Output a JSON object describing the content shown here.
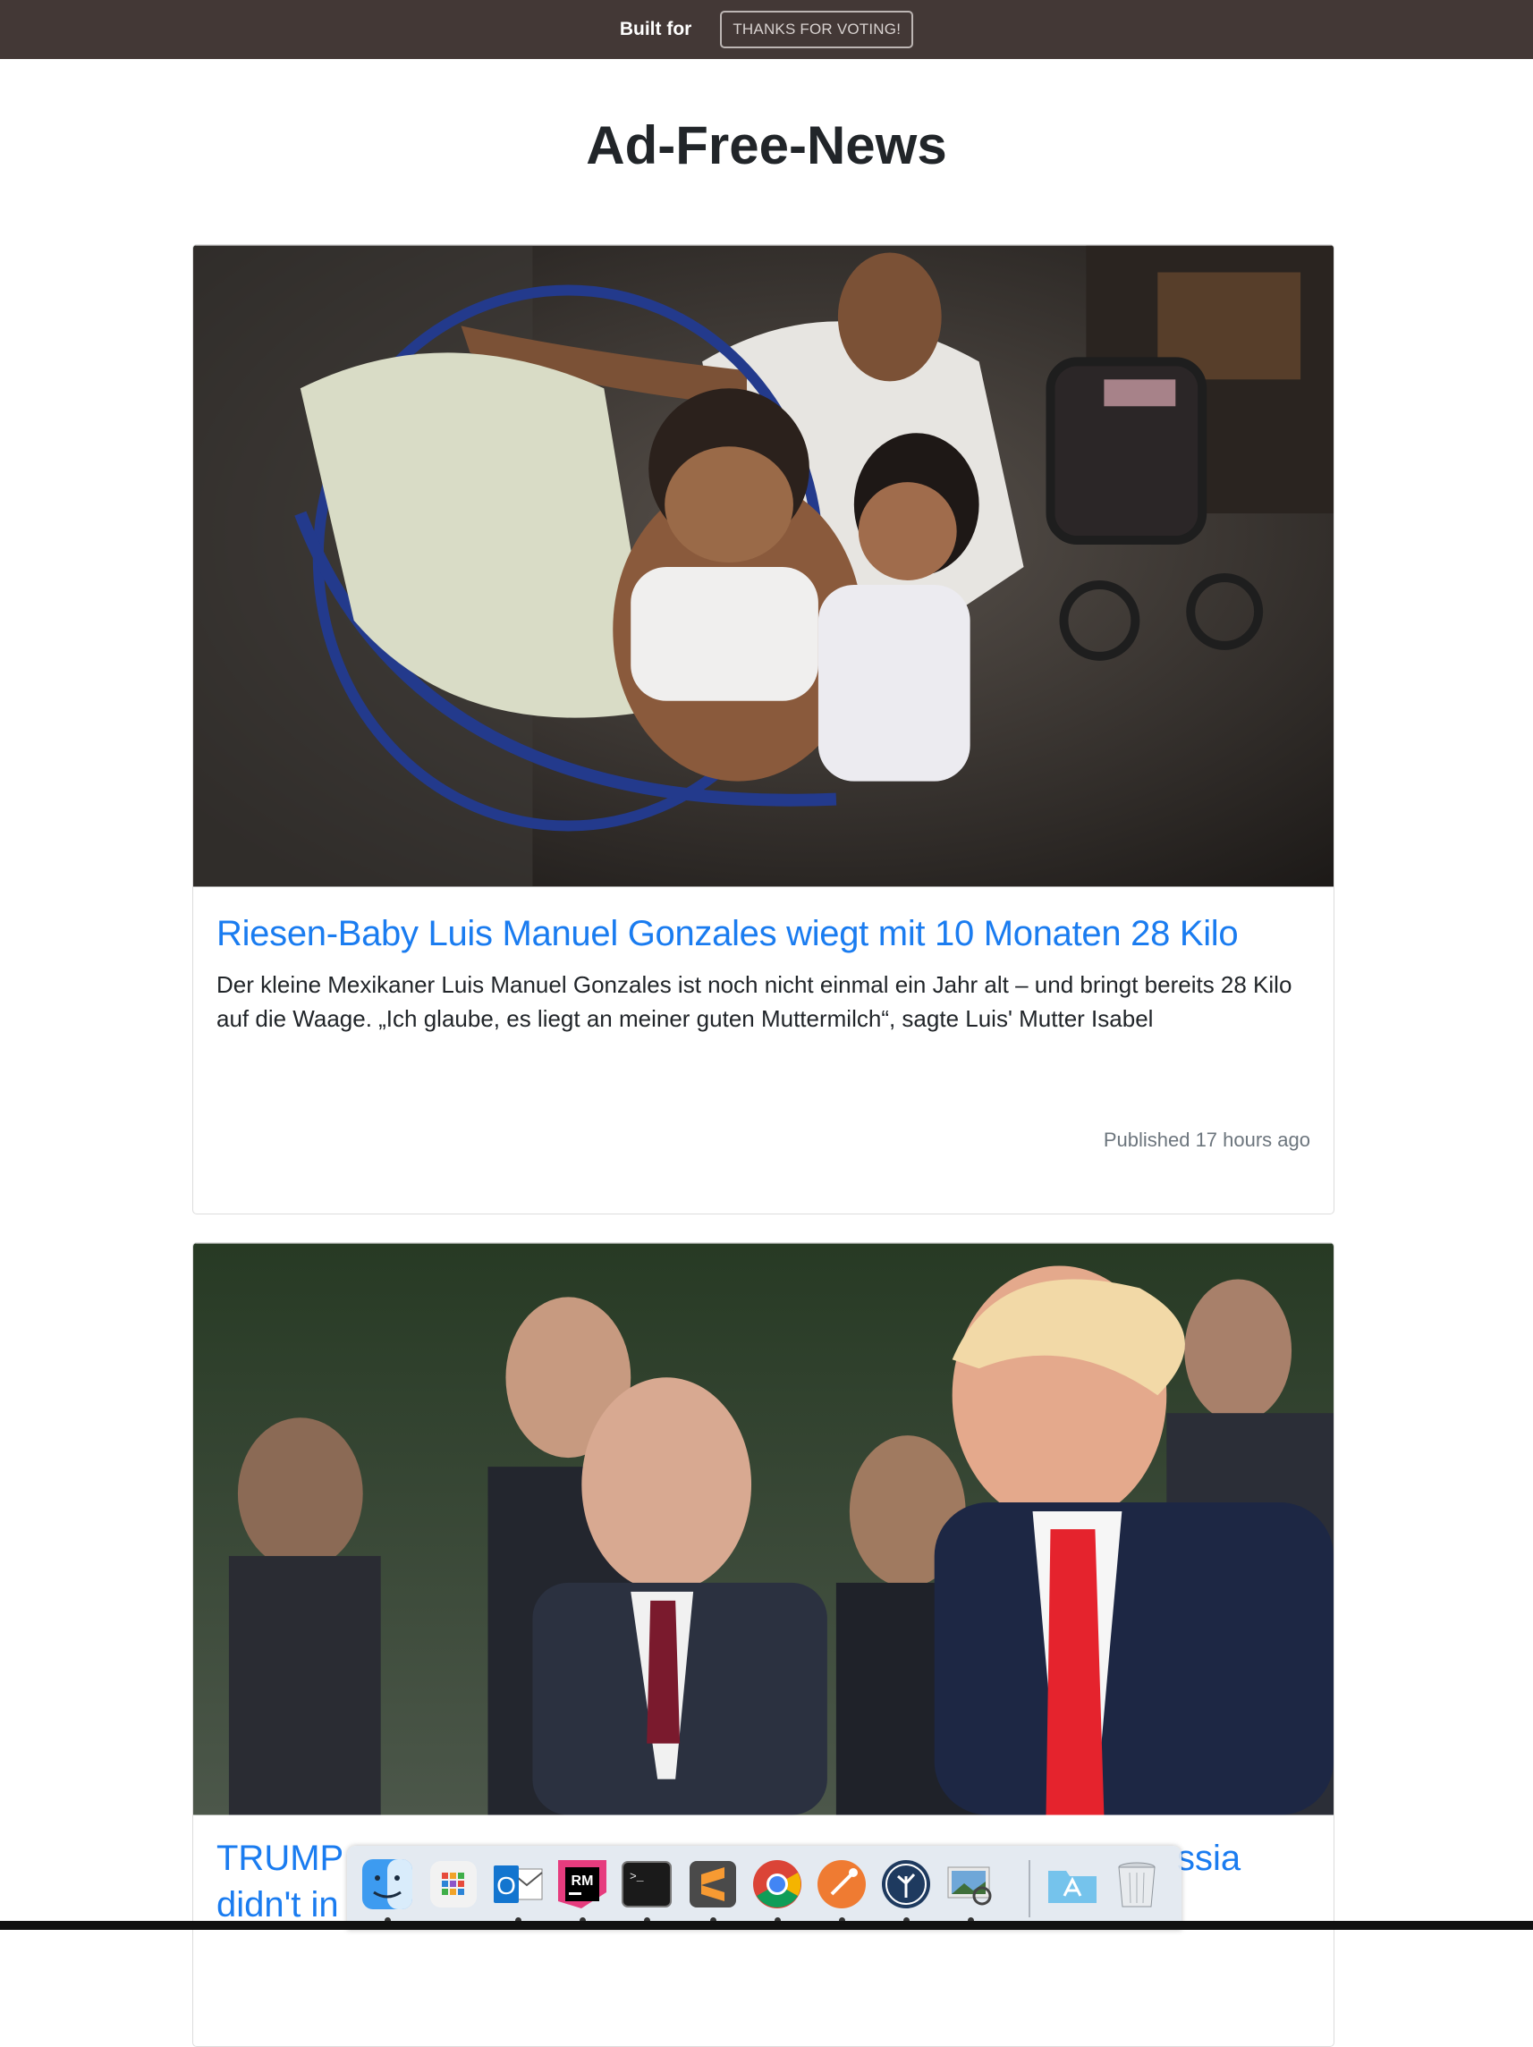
{
  "topbar": {
    "built_for": "Built for",
    "vote_button": "THANKS FOR VOTING!"
  },
  "page": {
    "title": "Ad-Free-News"
  },
  "articles": [
    {
      "title": "Riesen-Baby Luis Manuel Gonzales wiegt mit 10 Monaten 28 Kilo",
      "description": "Der kleine Mexikaner Luis Manuel Gonzales ist noch nicht einmal ein Jahr alt – und bringt bereits 28 Kilo auf die Waage. „Ich glaube, es liegt an meiner guten Muttermilch“, sagte Luis' Mutter Isabel",
      "published": "Published 17 hours ago"
    },
    {
      "title_partial_left": "TRUMP",
      "title_partial_right": "ssia",
      "title_partial_line2": "didn't in"
    }
  ],
  "dock": {
    "items": [
      "finder-icon",
      "launchpad-icon",
      "outlook-icon",
      "rubymine-icon",
      "terminal-icon",
      "sublime-text-icon",
      "chrome-icon",
      "postman-icon",
      "sourcetree-icon",
      "preview-icon",
      "applications-folder-icon",
      "trash-icon"
    ],
    "outlook_letter": "O",
    "rubymine_letters": "RM",
    "terminal_prompt": ">_"
  }
}
